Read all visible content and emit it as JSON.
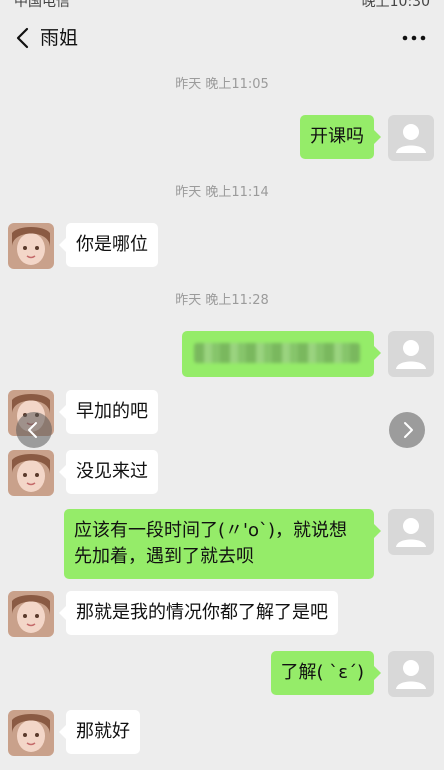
{
  "status_bar": {
    "carrier": "中国电信",
    "clock": "晚上10:30"
  },
  "header": {
    "title": "雨姐"
  },
  "messages": [
    {
      "kind": "time",
      "text": "昨天 晚上11:05"
    },
    {
      "kind": "out",
      "text": "开课吗"
    },
    {
      "kind": "time",
      "text": "昨天 晚上11:14"
    },
    {
      "kind": "in",
      "text": "你是哪位"
    },
    {
      "kind": "time",
      "text": "昨天 晚上11:28"
    },
    {
      "kind": "out",
      "text": "",
      "note": "blurred"
    },
    {
      "kind": "in",
      "text": "早加的吧"
    },
    {
      "kind": "in",
      "text": "没见来过"
    },
    {
      "kind": "out",
      "text": "应该有一段时间了(〃'o`)，就说想先加着，遇到了就去呗"
    },
    {
      "kind": "in",
      "text": "那就是我的情况你都了解了是吧"
    },
    {
      "kind": "out",
      "text": "了解( ˋεˊ)"
    },
    {
      "kind": "in",
      "text": "那就好"
    }
  ],
  "colors": {
    "background": "#ededed",
    "outgoing_bubble": "#95ec69",
    "incoming_bubble": "#ffffff",
    "timestamp_text": "#9b9b9b"
  }
}
